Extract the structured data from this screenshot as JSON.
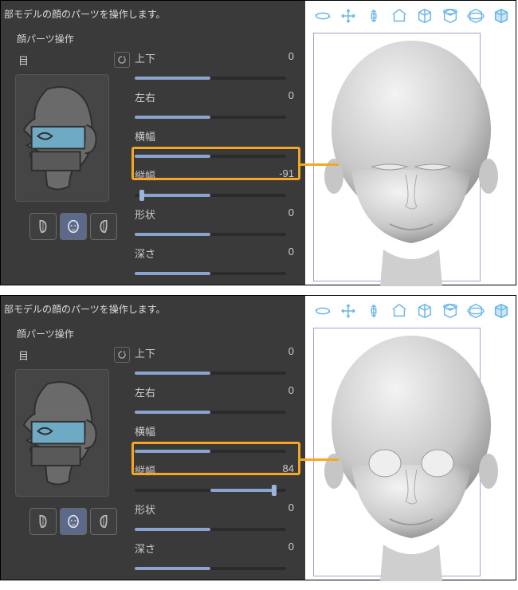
{
  "panels": [
    {
      "description": "部モデルの顔のパーツを操作します。",
      "section_title": "顔パーツ操作",
      "category": "目",
      "params": {
        "p0": {
          "label": "上下",
          "value": "0",
          "pos": 50
        },
        "p1": {
          "label": "左右",
          "value": "0",
          "pos": 50
        },
        "p2": {
          "label": "横幅",
          "value": "",
          "pos": 50
        },
        "p3": {
          "label": "縦幅",
          "value": "-91",
          "pos": 4.5
        },
        "p4": {
          "label": "形状",
          "value": "0",
          "pos": 50
        },
        "p5": {
          "label": "深さ",
          "value": "0",
          "pos": 50
        }
      },
      "highlighted_param_index": 3
    },
    {
      "description": "部モデルの顔のパーツを操作します。",
      "section_title": "顔パーツ操作",
      "category": "目",
      "params": {
        "p0": {
          "label": "上下",
          "value": "0",
          "pos": 50
        },
        "p1": {
          "label": "左右",
          "value": "0",
          "pos": 50
        },
        "p2": {
          "label": "横幅",
          "value": "",
          "pos": 50
        },
        "p3": {
          "label": "縦幅",
          "value": "84",
          "pos": 92
        },
        "p4": {
          "label": "形状",
          "value": "0",
          "pos": 50
        },
        "p5": {
          "label": "深さ",
          "value": "0",
          "pos": 50
        }
      },
      "highlighted_param_index": 3
    }
  ],
  "toolbar3d_icons": [
    "orbit-icon",
    "pan-icon",
    "zoom-icon",
    "home-icon",
    "cube-icon",
    "cube-top-icon",
    "cube-rotate-icon",
    "cube-shaded-icon"
  ],
  "view_buttons": [
    "profile-left-icon",
    "face-front-icon",
    "profile-right-icon"
  ],
  "selected_view_index": 1
}
